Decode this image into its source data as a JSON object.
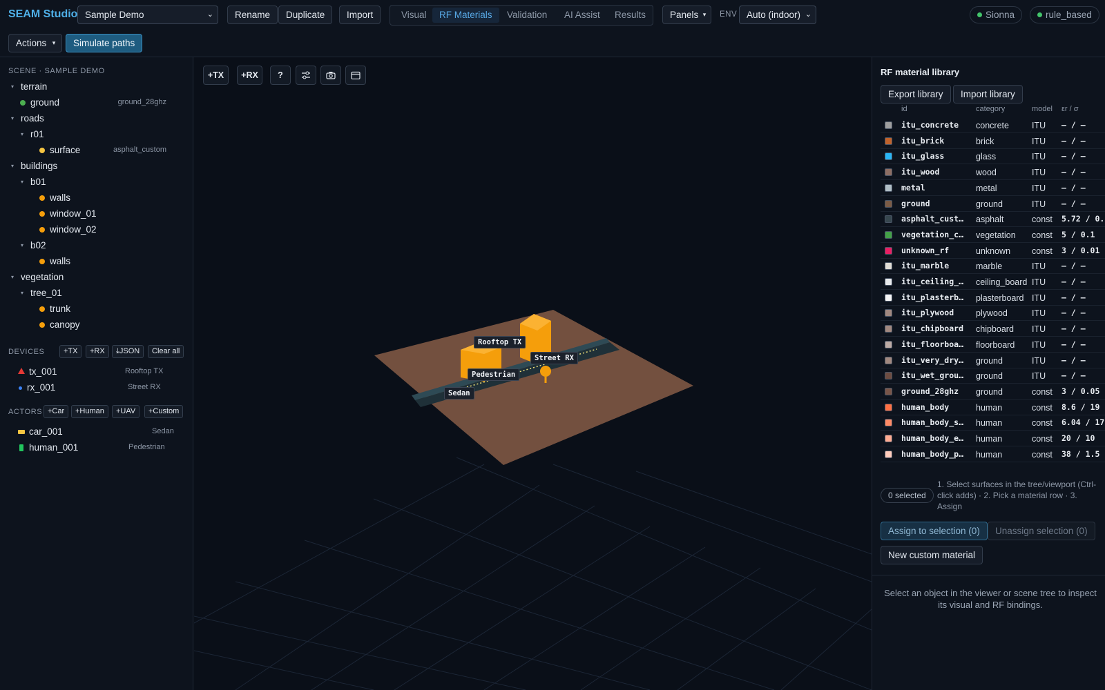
{
  "app": {
    "title": "SEAM Studio"
  },
  "toolbar": {
    "project_select": "Sample Demo",
    "rename": "Rename",
    "duplicate": "Duplicate",
    "import": "Import",
    "tabs": [
      {
        "label": "Visual",
        "active": false
      },
      {
        "label": "RF Materials",
        "active": true
      },
      {
        "label": "Validation",
        "active": false
      },
      {
        "label": "AI Assist",
        "active": false
      },
      {
        "label": "Results",
        "active": false
      }
    ],
    "panels": "Panels",
    "env_label": "ENV",
    "env_select": "Auto (indoor)",
    "status_pills": [
      "Sionna",
      "rule_based"
    ],
    "actions": "Actions",
    "simulate": "Simulate paths"
  },
  "scene": {
    "heading": "SCENE · SAMPLE DEMO",
    "tree": [
      {
        "label": "terrain",
        "level": 0,
        "type": "group"
      },
      {
        "label": "ground",
        "level": 1,
        "type": "leaf",
        "color": "#4caf50",
        "meta": "ground_28ghz"
      },
      {
        "label": "roads",
        "level": 0,
        "type": "group"
      },
      {
        "label": "r01",
        "level": 1,
        "type": "group"
      },
      {
        "label": "surface",
        "level": 2,
        "type": "leaf",
        "color": "#f5c542",
        "meta": "asphalt_custom"
      },
      {
        "label": "buildings",
        "level": 0,
        "type": "group"
      },
      {
        "label": "b01",
        "level": 1,
        "type": "group"
      },
      {
        "label": "walls",
        "level": 2,
        "type": "leaf",
        "color": "#f59e0b",
        "meta": ""
      },
      {
        "label": "window_01",
        "level": 2,
        "type": "leaf",
        "color": "#f59e0b",
        "meta": ""
      },
      {
        "label": "window_02",
        "level": 2,
        "type": "leaf",
        "color": "#f59e0b",
        "meta": ""
      },
      {
        "label": "b02",
        "level": 1,
        "type": "group"
      },
      {
        "label": "walls",
        "level": 2,
        "type": "leaf",
        "color": "#f59e0b",
        "meta": ""
      },
      {
        "label": "vegetation",
        "level": 0,
        "type": "group"
      },
      {
        "label": "tree_01",
        "level": 1,
        "type": "group"
      },
      {
        "label": "trunk",
        "level": 2,
        "type": "leaf",
        "color": "#f59e0b",
        "meta": ""
      },
      {
        "label": "canopy",
        "level": 2,
        "type": "leaf",
        "color": "#f59e0b",
        "meta": ""
      }
    ]
  },
  "devices": {
    "heading": "DEVICES",
    "buttons": [
      "+TX",
      "+RX",
      "⤓JSON",
      "Clear all"
    ],
    "items": [
      {
        "id": "tx_001",
        "name": "Rooftop TX",
        "icon": "triangle-icon",
        "color": "#e53935"
      },
      {
        "id": "rx_001",
        "name": "Street RX",
        "icon": "dot-icon",
        "color": "#3b82f6"
      }
    ]
  },
  "actors": {
    "heading": "ACTORS",
    "buttons": [
      "+Car",
      "+Human",
      "+UAV",
      "+Custom"
    ],
    "items": [
      {
        "id": "car_001",
        "name": "Sedan",
        "icon": "car-icon",
        "color": "#f5c542"
      },
      {
        "id": "human_001",
        "name": "Pedestrian",
        "icon": "human-icon",
        "color": "#22c55e"
      }
    ]
  },
  "viewport": {
    "tools": [
      "+TX",
      "+RX",
      "?"
    ],
    "labels": {
      "rooftop_tx": "Rooftop TX",
      "street_rx": "Street RX",
      "pedestrian": "Pedestrian",
      "sedan": "Sedan"
    }
  },
  "materials": {
    "title": "RF material library",
    "export": "Export library",
    "import": "Import library",
    "columns": [
      "id",
      "category",
      "model",
      "εr / σ"
    ],
    "rows": [
      {
        "id": "itu_concrete",
        "category": "concrete",
        "model": "ITU",
        "value": "– / –",
        "color": "#9e9e9e"
      },
      {
        "id": "itu_brick",
        "category": "brick",
        "model": "ITU",
        "value": "– / –",
        "color": "#c0622b"
      },
      {
        "id": "itu_glass",
        "category": "glass",
        "model": "ITU",
        "value": "– / –",
        "color": "#29b6f6"
      },
      {
        "id": "itu_wood",
        "category": "wood",
        "model": "ITU",
        "value": "– / –",
        "color": "#8d6e63"
      },
      {
        "id": "metal",
        "category": "metal",
        "model": "ITU",
        "value": "– / –",
        "color": "#b0bec5"
      },
      {
        "id": "ground",
        "category": "ground",
        "model": "ITU",
        "value": "– / –",
        "color": "#7b5b45"
      },
      {
        "id": "asphalt_cust…",
        "category": "asphalt",
        "model": "const",
        "value": "5.72 / 0.",
        "color": "#37474f"
      },
      {
        "id": "vegetation_c…",
        "category": "vegetation",
        "model": "const",
        "value": "5 / 0.1",
        "color": "#43a047"
      },
      {
        "id": "unknown_rf",
        "category": "unknown",
        "model": "const",
        "value": "3 / 0.01",
        "color": "#e91e63"
      },
      {
        "id": "itu_marble",
        "category": "marble",
        "model": "ITU",
        "value": "– / –",
        "color": "#e0dcd5"
      },
      {
        "id": "itu_ceiling_…",
        "category": "ceiling_board",
        "model": "ITU",
        "value": "– / –",
        "color": "#e8eaec"
      },
      {
        "id": "itu_plasterb…",
        "category": "plasterboard",
        "model": "ITU",
        "value": "– / –",
        "color": "#f5f5f5"
      },
      {
        "id": "itu_plywood",
        "category": "plywood",
        "model": "ITU",
        "value": "– / –",
        "color": "#a1887f"
      },
      {
        "id": "itu_chipboard",
        "category": "chipboard",
        "model": "ITU",
        "value": "– / –",
        "color": "#a1887f"
      },
      {
        "id": "itu_floorboa…",
        "category": "floorboard",
        "model": "ITU",
        "value": "– / –",
        "color": "#bcaaa4"
      },
      {
        "id": "itu_very_dry…",
        "category": "ground",
        "model": "ITU",
        "value": "– / –",
        "color": "#a1887f"
      },
      {
        "id": "itu_wet_grou…",
        "category": "ground",
        "model": "ITU",
        "value": "– / –",
        "color": "#6d4c41"
      },
      {
        "id": "ground_28ghz",
        "category": "ground",
        "model": "const",
        "value": "3 / 0.05",
        "color": "#795548"
      },
      {
        "id": "human_body",
        "category": "human",
        "model": "const",
        "value": "8.6 / 19",
        "color": "#ff7043"
      },
      {
        "id": "human_body_s…",
        "category": "human",
        "model": "const",
        "value": "6.04 / 17",
        "color": "#ff8a65"
      },
      {
        "id": "human_body_e…",
        "category": "human",
        "model": "const",
        "value": "20 / 10",
        "color": "#ffab91"
      },
      {
        "id": "human_body_p…",
        "category": "human",
        "model": "const",
        "value": "38 / 1.5",
        "color": "#ffccbc"
      }
    ],
    "selected": "0 selected",
    "hint": "1. Select surfaces in the tree/viewport (Ctrl-click adds) · 2. Pick a material row · 3. Assign",
    "assign": "Assign to selection (0)",
    "unassign": "Unassign selection (0)",
    "new_custom": "New custom material",
    "inspect_hint": "Select an object in the viewer or scene tree to inspect its visual and RF bindings."
  }
}
